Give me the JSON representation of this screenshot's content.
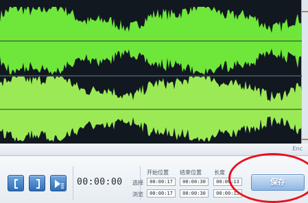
{
  "waveform": {
    "top_color": "#6fe63a",
    "bottom_color": "#9bea55",
    "background": "#111820",
    "center_line_color": "#2a3a2a"
  },
  "timeline": {
    "end_label": "Enc"
  },
  "controls": {
    "current_time": "00:00:00",
    "headers": {
      "start": "开始位置",
      "end": "结束位置",
      "length": "长度"
    },
    "rows": {
      "selection": {
        "label": "选择",
        "start": "00:00:17",
        "end": "00:00:30",
        "length": "00:00:13"
      },
      "preview": {
        "label": "浏览",
        "start": "00:00:17",
        "end": "00:00:30",
        "length": "00:00:13"
      }
    },
    "save_label": "保存"
  },
  "annotation": {
    "circle_color": "#e8101a"
  }
}
